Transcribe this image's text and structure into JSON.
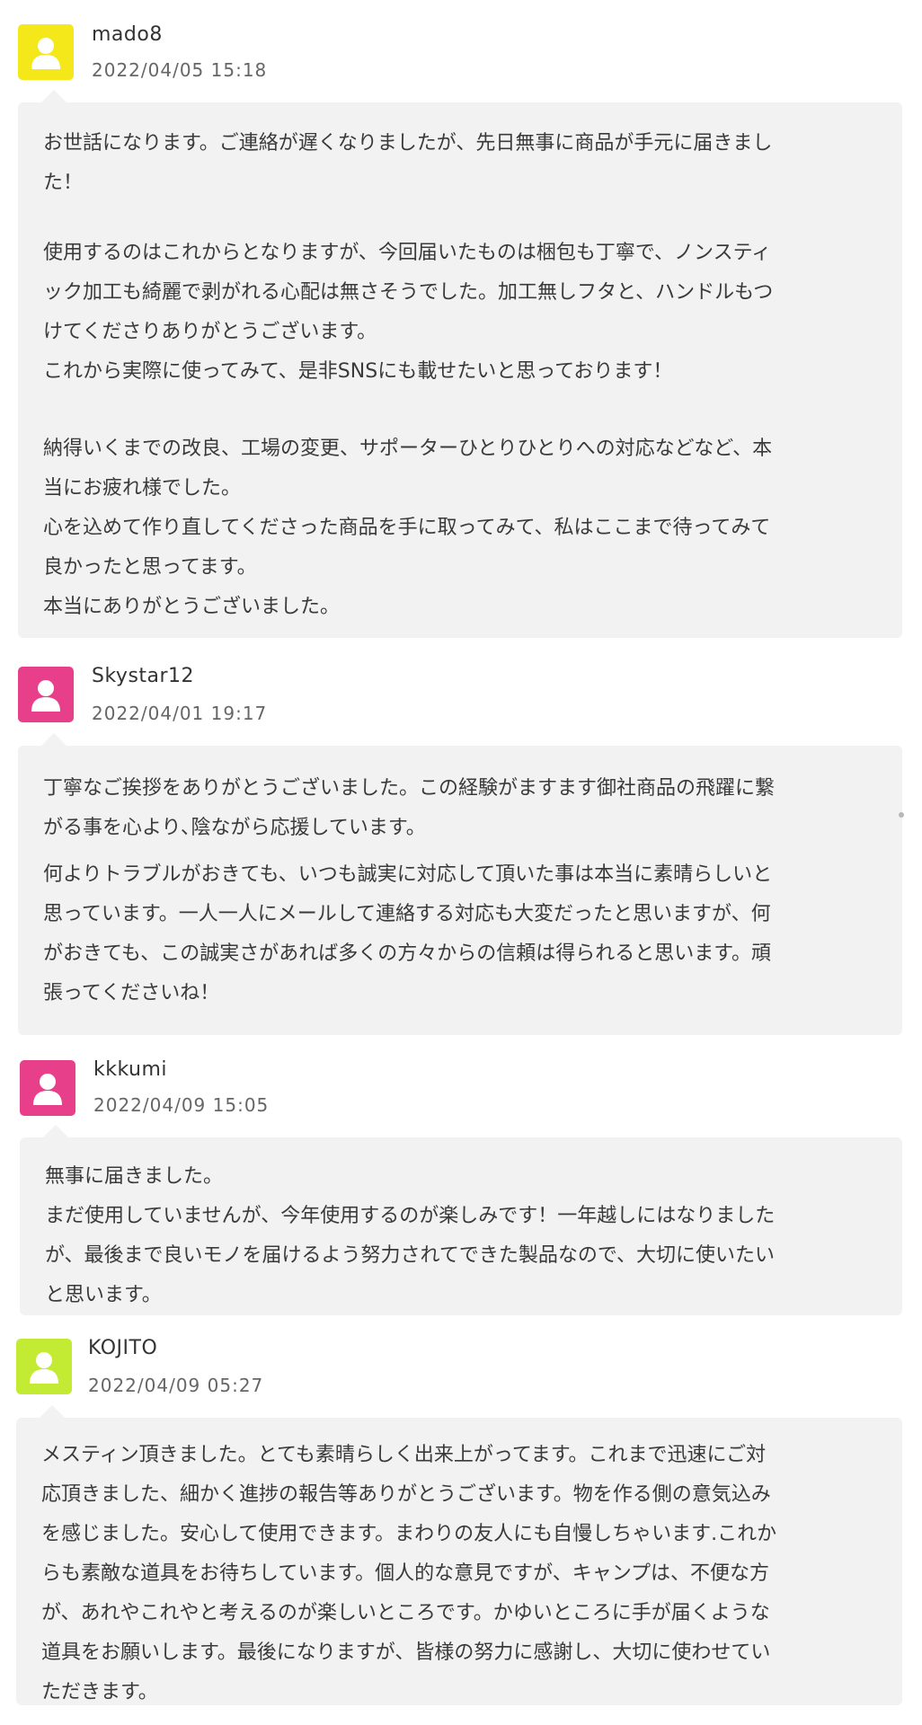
{
  "avatar_colors": [
    "#f4e81a",
    "#e83f8a",
    "#e83f8a",
    "#c4eb33"
  ],
  "bubble_color": "#f3f2f2",
  "comments": [
    {
      "author": "mado8",
      "date": "2022/04/05 15:18",
      "avatar_color": "#f4e81a",
      "paragraphs": [
        [
          "お世話になります。ご連絡が遅くなりましたが、先日無事に商品が手元に届きまし",
          "た！"
        ],
        [
          "使用するのはこれからとなりますが、今回届いたものは梱包も丁寧で、ノンスティ",
          "ック加工も綺麗で剥がれる心配は無さそうでした。加工無しフタと、ハンドルもつ",
          "けてくださりありがとうございます。",
          "これから実際に使ってみて、是非SNSにも載せたいと思っております！"
        ],
        [
          "納得いくまでの改良、工場の変更、サポーターひとりひとりへの対応などなど、本",
          "当にお疲れ様でした。",
          "心を込めて作り直してくださった商品を手に取ってみて、私はここまで待ってみて",
          "良かったと思ってます。",
          "本当にありがとうございました。"
        ]
      ]
    },
    {
      "author": "Skystar12",
      "date": "2022/04/01 19:17",
      "avatar_color": "#e83f8a",
      "paragraphs": [
        [
          "丁寧なご挨拶をありがとうございました。この経験がますます御社商品の飛躍に繋",
          "がる事を心より､陰ながら応援しています。"
        ],
        [
          "何よりトラブルがおきても、いつも誠実に対応して頂いた事は本当に素晴らしいと",
          "思っています。一人一人にメールして連絡する対応も大変だったと思いますが、何",
          "がおきても、この誠実さがあれば多くの方々からの信頼は得られると思います。頑",
          "張ってくださいね！"
        ]
      ]
    },
    {
      "author": "kkkumi",
      "date": "2022/04/09 15:05",
      "avatar_color": "#e83f8a",
      "paragraphs": [
        [
          "無事に届きました。",
          "まだ使用していませんが、今年使用するのが楽しみです！一年越しにはなりました",
          "が、最後まで良いモノを届けるよう努力されてできた製品なので、大切に使いたい",
          "と思います。"
        ]
      ]
    },
    {
      "author": "KOJITO",
      "date": "2022/04/09 05:27",
      "avatar_color": "#c4eb33",
      "paragraphs": [
        [
          "メスティン頂きました。とても素晴らしく出来上がってます。これまで迅速にご対",
          "応頂きました、細かく進捗の報告等ありがとうございます。物を作る側の意気込み",
          "を感じました。安心して使用できます。まわりの友人にも自慢しちゃいます.これか",
          "らも素敵な道具をお待ちしています。個人的な意見ですが、キャンプは、不便な方",
          "が、あれやこれやと考えるのが楽しいところです。かゆいところに手が届くような",
          "道具をお願いします。最後になりますが、皆様の努力に感謝し、大切に使わせてい",
          "ただきます。"
        ]
      ]
    }
  ]
}
